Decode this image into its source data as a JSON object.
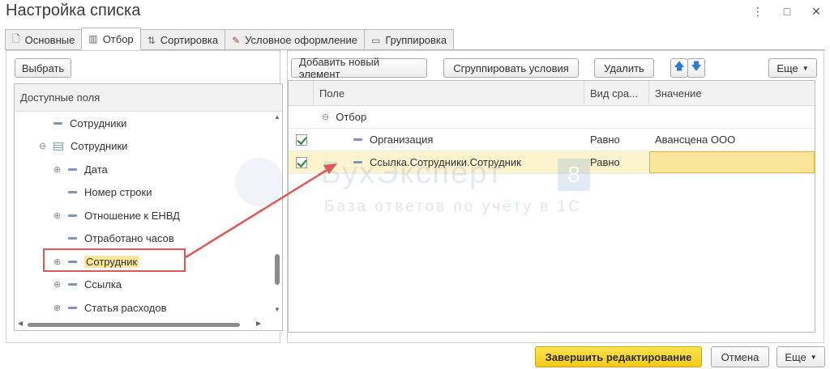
{
  "window": {
    "title": "Настройка списка",
    "controls": [
      "⋮",
      "□",
      "✕"
    ]
  },
  "tabs": [
    {
      "label": "Основные",
      "icon": "document-icon"
    },
    {
      "label": "Отбор",
      "icon": "filter-icon",
      "active": true
    },
    {
      "label": "Сортировка",
      "icon": "sort-icon"
    },
    {
      "label": "Условное оформление",
      "icon": "conditional-format-icon"
    },
    {
      "label": "Группировка",
      "icon": "grouping-icon"
    }
  ],
  "left": {
    "select_button": "Выбрать",
    "tree_header": "Доступные поля",
    "items": [
      {
        "label": "Сотрудники",
        "type": "field"
      },
      {
        "label": "Сотрудники",
        "type": "table",
        "expander": "⊖"
      },
      {
        "label": "Дата",
        "type": "field",
        "expander": "⊕"
      },
      {
        "label": "Номер строки",
        "type": "field"
      },
      {
        "label": "Отношение к ЕНВД",
        "type": "field",
        "expander": "⊕"
      },
      {
        "label": "Отработано часов",
        "type": "field"
      },
      {
        "label": "Сотрудник",
        "type": "field",
        "expander": "⊕",
        "highlighted": true
      },
      {
        "label": "Ссылка",
        "type": "field",
        "expander": "⊕"
      },
      {
        "label": "Статья расходов",
        "type": "field",
        "expander": "⊕"
      }
    ]
  },
  "right": {
    "toolbar": {
      "add": "Добавить новый элемент",
      "group": "Сгруппировать условия",
      "delete": "Удалить",
      "up": "🡅",
      "down": "🡇",
      "more": "Еще"
    },
    "columns": [
      "Поле",
      "Вид сра...",
      "Значение"
    ],
    "group_row": {
      "expander": "⊖",
      "label": "Отбор"
    },
    "rows": [
      {
        "checked": true,
        "field": "Организация",
        "kind": "Равно",
        "value": "Авансцена ООО"
      },
      {
        "checked": true,
        "field": "Ссылка.Сотрудники.Сотрудник",
        "kind": "Равно",
        "value": ""
      }
    ]
  },
  "watermark": {
    "title": "БухЭксперт",
    "badge": "8",
    "subtitle": "База ответов по учёту в 1С"
  },
  "footer": {
    "finish": "Завершить редактирование",
    "cancel": "Отмена",
    "more": "Еще"
  },
  "colors": {
    "accent_yellow": "#f6c915",
    "highlight_red": "#e05757",
    "check_green": "#1f8a33"
  }
}
